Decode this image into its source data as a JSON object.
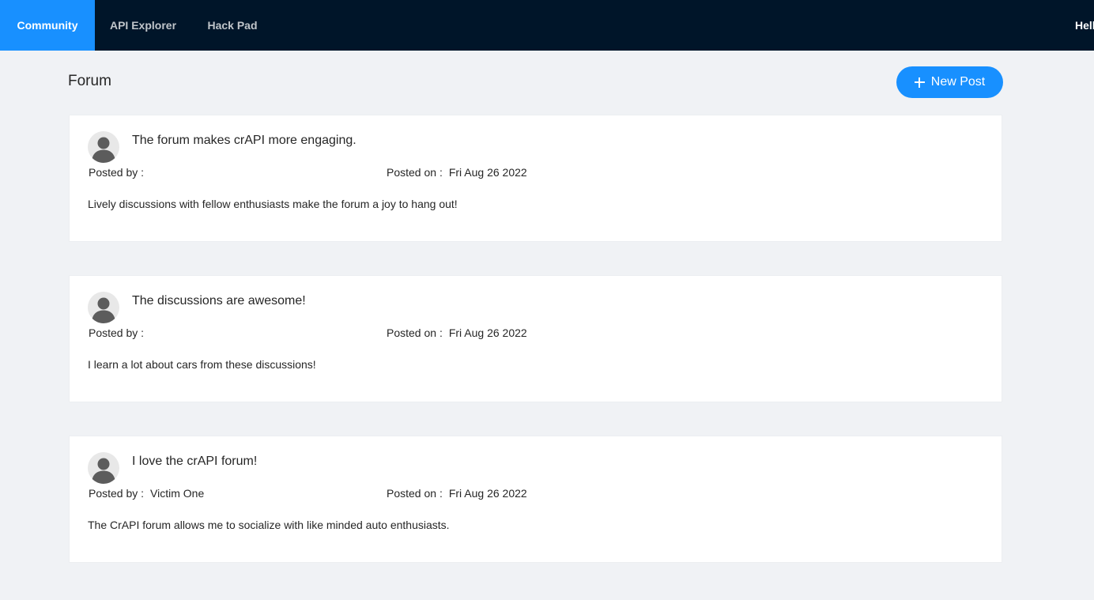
{
  "nav": {
    "tabs": [
      {
        "label": "Community",
        "active": true
      },
      {
        "label": "API Explorer",
        "active": false
      },
      {
        "label": "Hack Pad",
        "active": false
      }
    ],
    "greeting": "Hell"
  },
  "page": {
    "title": "Forum",
    "new_post_label": "New Post"
  },
  "labels": {
    "posted_by": "Posted by :",
    "posted_on": "Posted on :"
  },
  "posts": [
    {
      "title": "The forum makes crAPI more engaging.",
      "author": "",
      "date": "Fri Aug 26 2022",
      "body": "Lively discussions with fellow enthusiasts make the forum a joy to hang out!"
    },
    {
      "title": "The discussions are awesome!",
      "author": "",
      "date": "Fri Aug 26 2022",
      "body": "I learn a lot about cars from these discussions!"
    },
    {
      "title": "I love the crAPI forum!",
      "author": "Victim One",
      "date": "Fri Aug 26 2022",
      "body": "The CrAPI forum allows me to socialize with like minded auto enthusiasts."
    }
  ],
  "colors": {
    "nav_bg": "#001529",
    "accent": "#1890ff",
    "page_bg": "#f0f2f5"
  }
}
